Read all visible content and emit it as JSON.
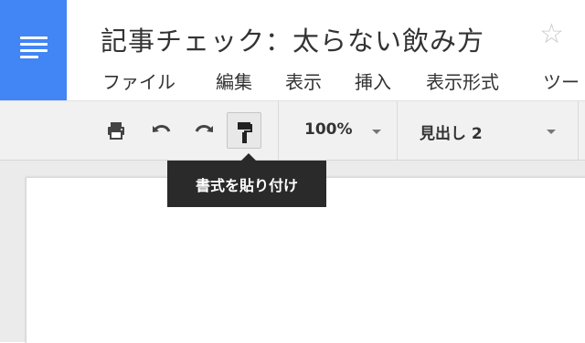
{
  "app": {
    "doc_title": "記事チェック：太らない飲み方",
    "accent_color": "#4285f4"
  },
  "menu": {
    "items": [
      "ファイル",
      "編集",
      "表示",
      "挿入",
      "表示形式",
      "ツー"
    ]
  },
  "toolbar": {
    "zoom": "100%",
    "paragraph_style": "見出し 2",
    "tooltip": "書式を貼り付け"
  },
  "icons": {
    "logo": "docs-logo-icon",
    "star": "star-outline-icon",
    "print": "print-icon",
    "undo": "undo-icon",
    "redo": "redo-icon",
    "paint_format": "paint-roller-icon"
  }
}
